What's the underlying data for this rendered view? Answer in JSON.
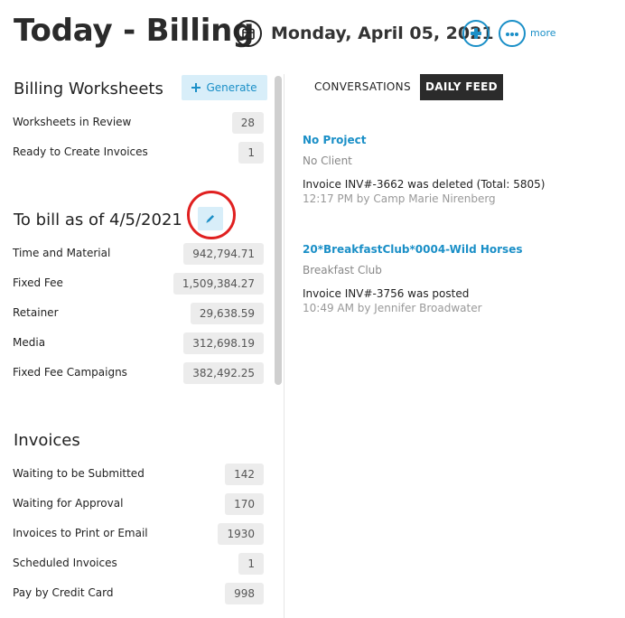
{
  "header": {
    "title": "Today - Billing",
    "date": "Monday, April 05, 2021",
    "more_label": "more",
    "icons": {
      "calendar": "calendar-icon",
      "add": "plus-icon",
      "more": "ellipsis-icon"
    }
  },
  "billing_worksheets": {
    "title": "Billing Worksheets",
    "generate_label": "Generate",
    "rows": [
      {
        "label": "Worksheets in Review",
        "value": "28"
      },
      {
        "label": "Ready to Create Invoices",
        "value": "1"
      }
    ]
  },
  "to_bill": {
    "title": "To bill as of 4/5/2021",
    "edit_icon": "pencil-icon",
    "rows": [
      {
        "label": "Time and Material",
        "value": "942,794.71"
      },
      {
        "label": "Fixed Fee",
        "value": "1,509,384.27"
      },
      {
        "label": "Retainer",
        "value": "29,638.59"
      },
      {
        "label": "Media",
        "value": "312,698.19"
      },
      {
        "label": "Fixed Fee Campaigns",
        "value": "382,492.25"
      }
    ]
  },
  "invoices": {
    "title": "Invoices",
    "rows": [
      {
        "label": "Waiting to be Submitted",
        "value": "142"
      },
      {
        "label": "Waiting for Approval",
        "value": "170"
      },
      {
        "label": "Invoices to Print or Email",
        "value": "1930"
      },
      {
        "label": "Scheduled Invoices",
        "value": "1"
      },
      {
        "label": "Pay by Credit Card",
        "value": "998"
      }
    ]
  },
  "tabs": [
    {
      "label": "CONVERSATIONS",
      "active": false
    },
    {
      "label": "DAILY FEED",
      "active": true
    }
  ],
  "feed": [
    {
      "project": "No Project",
      "client": "No Client",
      "message": "Invoice INV#-3662 was deleted (Total: 5805)",
      "meta": "12:17 PM by Camp Marie Nirenberg"
    },
    {
      "project": "20*BreakfastClub*0004-Wild Horses",
      "client": "Breakfast Club",
      "message": "Invoice INV#-3756 was posted",
      "meta": "10:49 AM by Jennifer Broadwater"
    }
  ],
  "colors": {
    "accent": "#1a8fc7",
    "highlight_ring": "#e02020",
    "active_tab_bg": "#2b2b2b",
    "badge_bg": "#ececec"
  }
}
